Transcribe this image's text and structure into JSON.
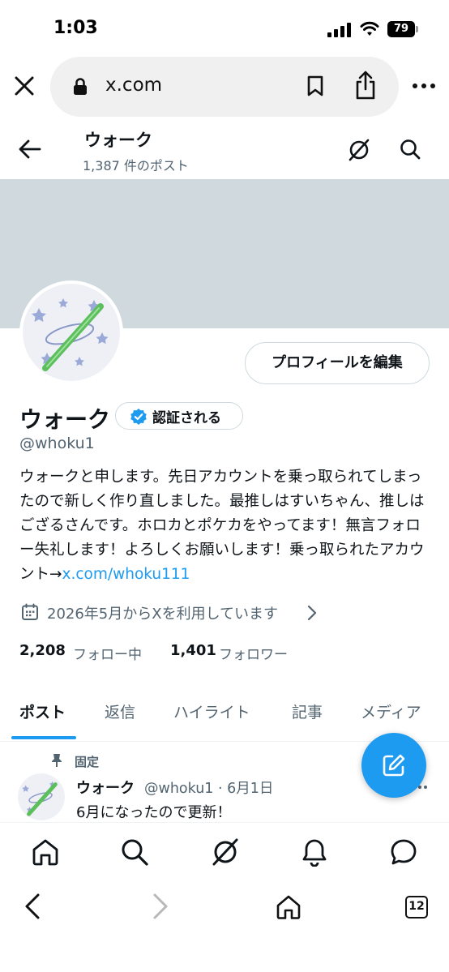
{
  "status_bar": {
    "time": "1:03",
    "battery": "79"
  },
  "browser": {
    "url": "x.com"
  },
  "header": {
    "name": "ウォーク",
    "post_count": "1,387 件のポスト"
  },
  "profile": {
    "edit_button": "プロフィールを編集",
    "name": "ウォーク",
    "verified_label": "認証される",
    "handle": "@whoku1",
    "bio_text": "ウォークと申します。先日アカウントを乗っ取られてしまったので新しく作り直しました。最推しはすいちゃん、推しはござるさんです。ホロカとポケカをやってます！無言フォロー失礼します！よろしくお願いします！乗っ取られたアカウント→",
    "bio_link": "x.com/whoku111",
    "joined": "2026年5月からXを利用しています",
    "following_count": "2,208",
    "following_label": "フォロー中",
    "followers_count": "1,401",
    "followers_label": "フォロワー"
  },
  "tabs": [
    {
      "label": "ポスト",
      "active": true
    },
    {
      "label": "返信"
    },
    {
      "label": "ハイライト"
    },
    {
      "label": "記事"
    },
    {
      "label": "メディア"
    }
  ],
  "pinned_post": {
    "pinned_label": "固定",
    "author": "ウォーク",
    "meta": "@whoku1 · 6月1日",
    "text": "6月になったので更新！"
  },
  "bottom_nav": [
    "home-icon",
    "search-icon",
    "grok-icon",
    "notifications-icon",
    "messages-icon"
  ],
  "safari": {
    "tab_count": "12"
  },
  "colors": {
    "accent": "#1d9bf0",
    "banner": "#cfd9de",
    "secondary_text": "#536471"
  }
}
